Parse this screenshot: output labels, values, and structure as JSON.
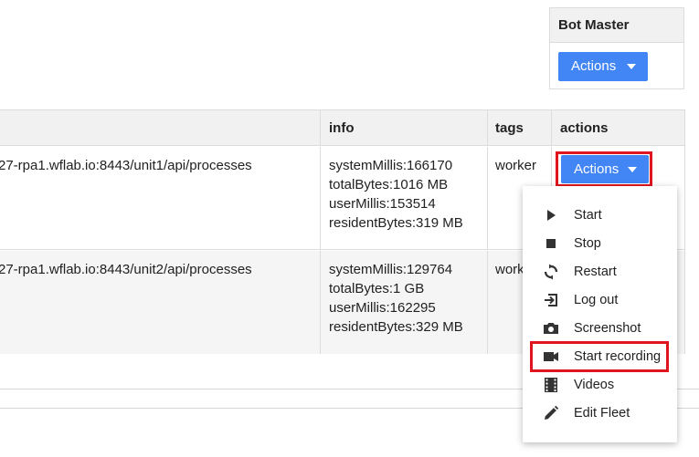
{
  "bot_master": {
    "title": "Bot Master",
    "actions_label": "Actions"
  },
  "table": {
    "headers": {
      "info": "info",
      "tags": "tags",
      "actions": "actions"
    },
    "rows": [
      {
        "url": "27-rpa1.wflab.io:8443/unit1/api/processes",
        "info": [
          "systemMillis:166170",
          "totalBytes:1016 MB",
          "userMillis:153514",
          "residentBytes:319 MB"
        ],
        "tags": "worker",
        "actions_label": "Actions"
      },
      {
        "url": "27-rpa1.wflab.io:8443/unit2/api/processes",
        "info": [
          "systemMillis:129764",
          "totalBytes:1 GB",
          "userMillis:162295",
          "residentBytes:329 MB"
        ],
        "tags": "work"
      }
    ]
  },
  "menu": {
    "items": [
      {
        "label": "Start",
        "icon": "play-icon"
      },
      {
        "label": "Stop",
        "icon": "stop-icon"
      },
      {
        "label": "Restart",
        "icon": "restart-icon"
      },
      {
        "label": "Log out",
        "icon": "logout-icon"
      },
      {
        "label": "Screenshot",
        "icon": "camera-icon"
      },
      {
        "label": "Start recording",
        "icon": "videocam-icon"
      },
      {
        "label": "Videos",
        "icon": "film-icon"
      },
      {
        "label": "Edit Fleet",
        "icon": "pencil-icon"
      }
    ]
  },
  "colors": {
    "primary_button": "#4285f4",
    "highlight_border": "#e0151f",
    "header_bg": "#f1f1f1",
    "icon": "#333333"
  }
}
